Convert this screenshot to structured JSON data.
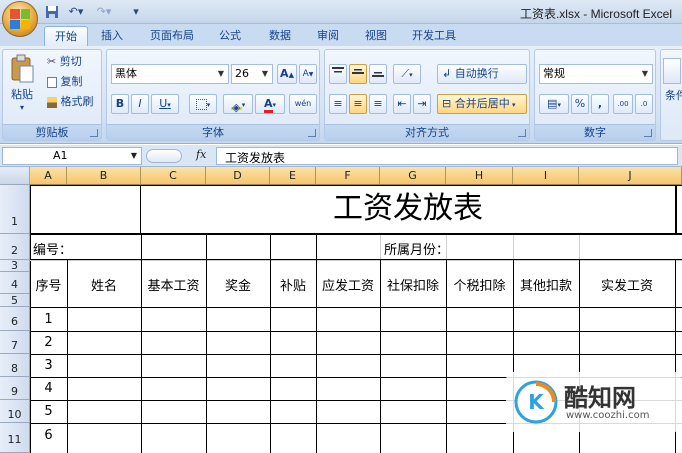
{
  "window": {
    "title": "工资表.xlsx - Microsoft Excel"
  },
  "tabs": [
    {
      "label": "开始",
      "active": true
    },
    {
      "label": "插入",
      "active": false
    },
    {
      "label": "页面布局",
      "active": false
    },
    {
      "label": "公式",
      "active": false
    },
    {
      "label": "数据",
      "active": false
    },
    {
      "label": "审阅",
      "active": false
    },
    {
      "label": "视图",
      "active": false
    },
    {
      "label": "开发工具",
      "active": false
    }
  ],
  "ribbon": {
    "clipboard": {
      "label": "剪贴板",
      "paste": "粘贴",
      "cut": "剪切",
      "copy": "复制",
      "format_painter": "格式刷"
    },
    "font": {
      "label": "字体",
      "font_name": "黑体",
      "font_size": "26",
      "bold": "B",
      "italic": "I",
      "underline": "U",
      "grow": "A",
      "shrink": "A",
      "font_color_glyph": "A",
      "phonetic": "wén"
    },
    "alignment": {
      "label": "对齐方式",
      "wrap_text": "自动换行",
      "merge_center": "合并后居中"
    },
    "number": {
      "label": "数字",
      "format": "常规",
      "percent": "%",
      "comma": ",",
      "inc_decimal": ".00",
      "dec_decimal": ".0"
    },
    "styles": {
      "label_partial": "条件"
    }
  },
  "formula_bar": {
    "name_box": "A1",
    "fx": "fx",
    "content": "工资发放表"
  },
  "sheet": {
    "columns": [
      "A",
      "B",
      "C",
      "D",
      "E",
      "F",
      "G",
      "H",
      "I",
      "J"
    ],
    "rows": [
      "1",
      "2",
      "3",
      "4",
      "5",
      "6",
      "7",
      "8",
      "9",
      "10",
      "11"
    ],
    "title": "工资发放表",
    "label_number": "编号：",
    "label_month": "所属月份：",
    "headers": [
      "序号",
      "姓名",
      "基本工资",
      "奖金",
      "补贴",
      "应发工资",
      "社保扣除",
      "个税扣除",
      "其他扣款",
      "实发工资"
    ],
    "serials": [
      "1",
      "2",
      "3",
      "4",
      "5",
      "6"
    ]
  },
  "watermark": {
    "brand": "酷知网",
    "url": "www.coozhi.com",
    "logo_letter": "K"
  },
  "colors": {
    "accent": "#15428b",
    "header_orange": "#f6c56c",
    "ribbon_bg": "#d4e2f3"
  }
}
